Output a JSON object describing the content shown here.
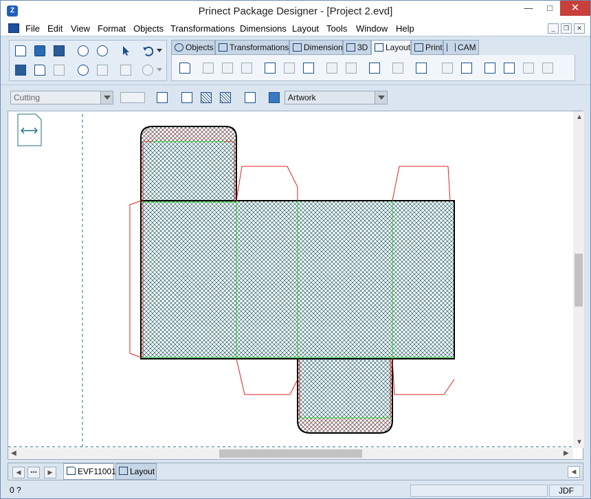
{
  "window": {
    "title": "Prinect Package Designer - [Project 2.evd]",
    "controls": {
      "minimize": "—",
      "maximize": "□",
      "close": "✕"
    }
  },
  "menu": {
    "items": [
      "File",
      "Edit",
      "View",
      "Format",
      "Objects",
      "Transformations",
      "Dimensions",
      "Layout",
      "Tools",
      "Window",
      "Help"
    ],
    "mdi": {
      "minimize": "_",
      "restore": "❐",
      "close": "✕"
    }
  },
  "tabs": [
    {
      "label": "Objects",
      "icon": "objects-icon"
    },
    {
      "label": "Transformations",
      "icon": "transformations-icon"
    },
    {
      "label": "Dimensions",
      "icon": "dimensions-icon"
    },
    {
      "label": "3D",
      "icon": "3d-cube-icon"
    },
    {
      "label": "Layout",
      "icon": "layout-grid-icon",
      "active": true
    },
    {
      "label": "Print",
      "icon": "print-icon"
    },
    {
      "label": "CAM",
      "icon": "cam-icon"
    }
  ],
  "toolbar2": {
    "mode_combo": {
      "value": "Cutting",
      "enabled": false
    },
    "layer_combo": {
      "value": "Artwork",
      "enabled": true
    }
  },
  "sheet_tabs": [
    {
      "label": "EVF11001",
      "icon": "document-icon",
      "active": true
    },
    {
      "label": "Layout",
      "icon": "layout-grid-icon",
      "active": false
    }
  ],
  "status": {
    "left": "0 ?",
    "right": "JDF"
  },
  "colors": {
    "cut_line": "#e02020",
    "crease_line": "#22cc22",
    "outline": "#000000",
    "hatch": "#1f5f66",
    "accent": "#1f5fb8"
  }
}
